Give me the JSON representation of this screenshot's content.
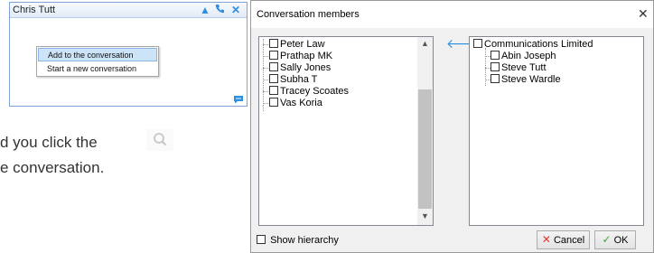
{
  "chat": {
    "title": "Chris Tutt",
    "menu": {
      "add": "Add to the conversation",
      "new": "Start a new conversation"
    }
  },
  "background": {
    "line1": "d you click the",
    "line2": "e conversation."
  },
  "dialog": {
    "title": "Conversation members",
    "available": [
      "Peter Law",
      "Prathap MK",
      "Sally Jones",
      "Subha T",
      "Tracey Scoates",
      "Vas Koria"
    ],
    "group": "Communications Limited",
    "members": [
      "Abin Joseph",
      "Steve Tutt",
      "Steve Wardle"
    ],
    "show_hierarchy": "Show hierarchy",
    "cancel": "Cancel",
    "ok": "OK"
  },
  "colors": {
    "accent": "#2e8ee0",
    "selection": "#cde3f8"
  }
}
